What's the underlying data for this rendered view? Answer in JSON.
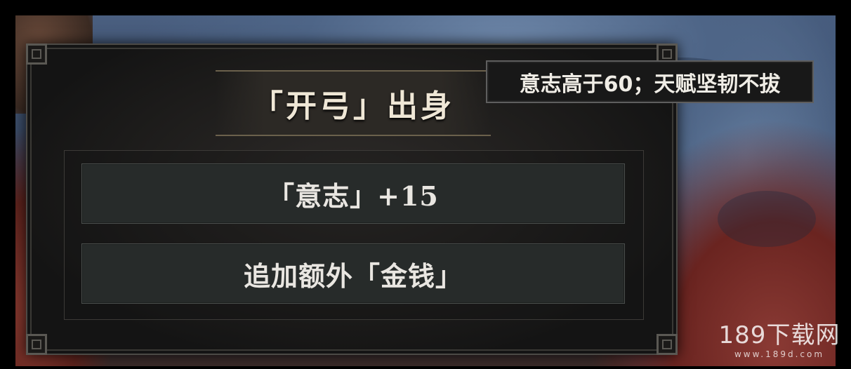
{
  "dialog": {
    "title": "「开弓」出身",
    "options": [
      {
        "label": "「意志」+15"
      },
      {
        "label": "追加额外「金钱」"
      }
    ]
  },
  "tooltip": {
    "text": "意志高于60；天赋坚韧不拔"
  },
  "watermark": {
    "main": "189下载网",
    "url": "www.189d.com"
  },
  "colors": {
    "panel_bg": "#1c1b1a",
    "title_text": "#efe7d6",
    "option_bg": "#272b2a",
    "gold_trim": "#6b614c"
  }
}
